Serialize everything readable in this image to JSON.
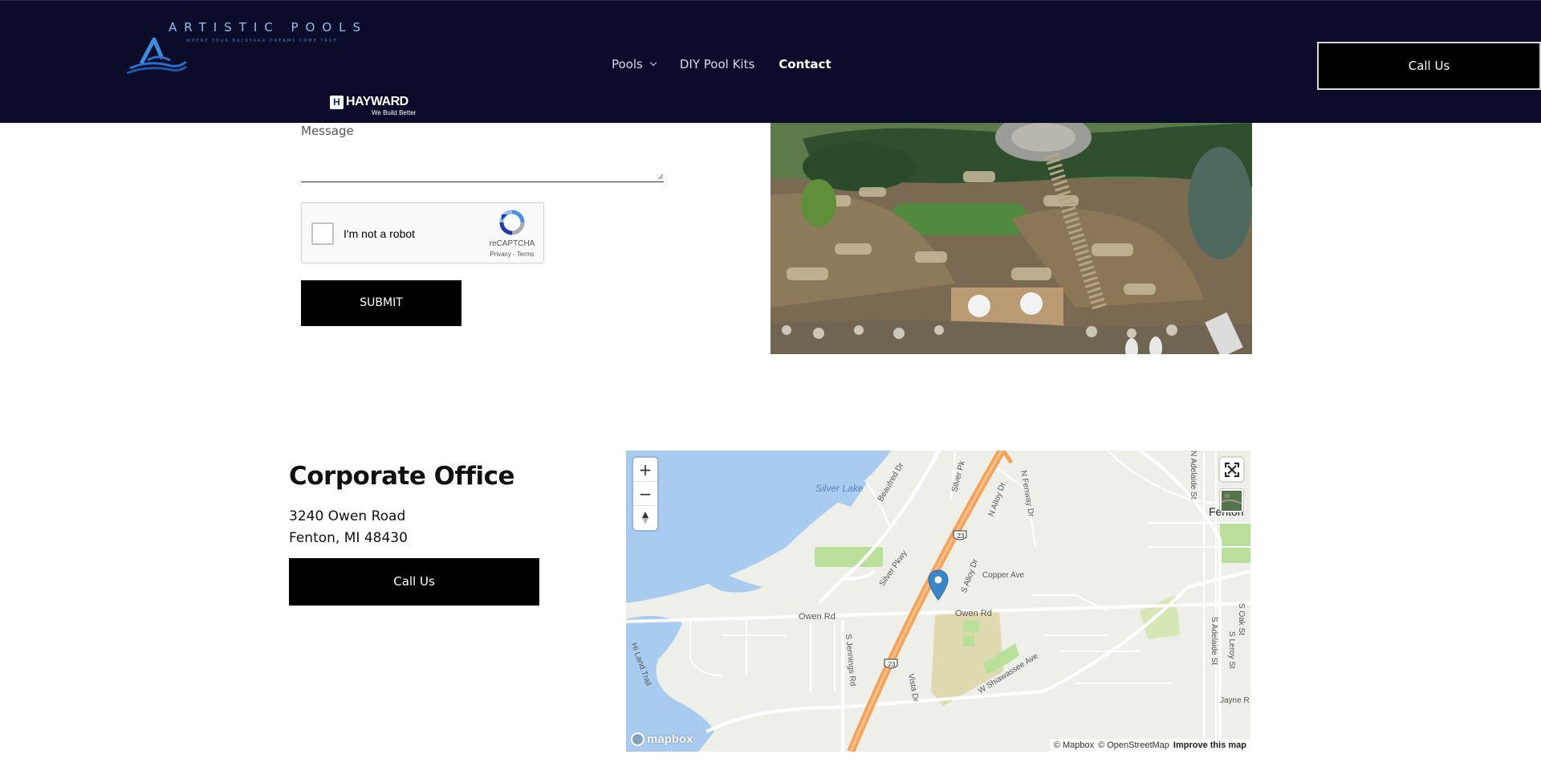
{
  "header": {
    "logo_title": "ARTISTIC POOLS",
    "logo_tagline": "WHERE YOUR BACKYARD DREAMS COME TRUE",
    "partner_name": "HAYWARD",
    "partner_mark": "H",
    "partner_slogan": "We Build Better",
    "nav": [
      {
        "label": "Pools",
        "has_dropdown": true,
        "active": false
      },
      {
        "label": "DIY Pool Kits",
        "has_dropdown": false,
        "active": false
      },
      {
        "label": "Contact",
        "has_dropdown": false,
        "active": true
      }
    ],
    "cta_label": "Call Us"
  },
  "form": {
    "message_label": "Message",
    "message_value": "",
    "recaptcha": {
      "label": "I'm not a robot",
      "brand": "reCAPTCHA",
      "links": "Privacy - Terms",
      "checked": false
    },
    "submit_label": "SUBMIT"
  },
  "office": {
    "title": "Corporate Office",
    "address_line1": "3240 Owen Road",
    "address_line2": "Fenton, MI 48430",
    "cta_label": "Call Us"
  },
  "map": {
    "labels": {
      "silver_lake": "Silver Lake",
      "fenton": "Fenton",
      "owen_rd_west": "Owen Rd",
      "owen_rd_east": "Owen Rd",
      "copper_ave": "Copper Ave",
      "silver_pkwy": "Silver Pkwy",
      "silver_pk_north": "Silver Pk",
      "beaufred": "Beaufred Dr",
      "n_alloy": "N Alloy Dr",
      "s_alloy": "S Alloy Dr",
      "n_fenway": "N Fenway Dr",
      "s_jennings": "S Jennings Rd",
      "vista": "Vista Dr",
      "w_shiawassee": "W Shiawassee Ave",
      "hi_land": "Hi Land Trail",
      "n_adelaide": "N Adelaide St",
      "s_adelaide": "S Adelaide St",
      "s_leroy": "S Leroy St",
      "s_oak": "S Oak St",
      "jayne": "Jayne R",
      "us23_top": "23",
      "us23_bottom": "23"
    },
    "zoom_in": "+",
    "zoom_out": "−",
    "attribution_mapbox": "© Mapbox",
    "attribution_osm": "© OpenStreetMap",
    "improve": "Improve this map",
    "logo_text": "mapbox",
    "colors": {
      "water": "#a9cbf0",
      "park": "#b8e09a",
      "land": "#efefea",
      "highway": "#f5a259",
      "marker": "#3a86c8"
    }
  }
}
